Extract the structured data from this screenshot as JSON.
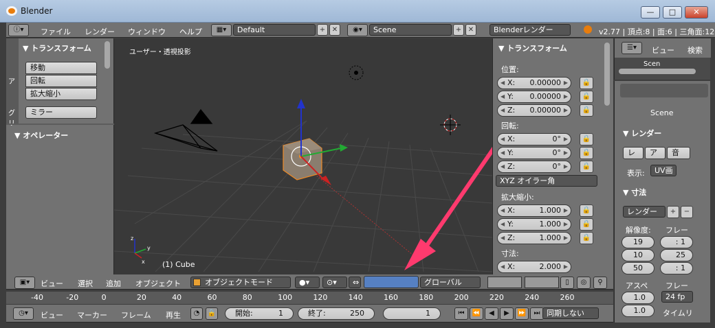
{
  "window": {
    "title": "Blender",
    "min": "—",
    "max": "□",
    "close": "✕"
  },
  "info_header": {
    "menus": [
      "ファイル",
      "レンダー",
      "ウィンドウ",
      "ヘルプ"
    ],
    "layout": "Default",
    "scene": "Scene",
    "engine": "Blenderレンダー",
    "stats": "v2.77 | 頂点:8 | 面:6 | 三角面:12"
  },
  "toolshelf": {
    "tabs": [
      "ア",
      "グリ"
    ],
    "transform_title": "▼ トランスフォーム",
    "buttons": [
      "移動",
      "回転",
      "拡大縮小"
    ],
    "mirror": "ミラー",
    "operator_title": "▼ オペレーター"
  },
  "viewport": {
    "label": "ユーザー・透視投影",
    "object_label": "(1) Cube",
    "axis_x": "x",
    "axis_y": "y",
    "axis_z": "z"
  },
  "properties_panel": {
    "title": "▼ トランスフォーム",
    "location_label": "位置:",
    "location": [
      {
        "axis": "X:",
        "value": "0.00000"
      },
      {
        "axis": "Y:",
        "value": "0.00000"
      },
      {
        "axis": "Z:",
        "value": "0.00000"
      }
    ],
    "rotation_label": "回転:",
    "rotation": [
      {
        "axis": "X:",
        "value": "0°"
      },
      {
        "axis": "Y:",
        "value": "0°"
      },
      {
        "axis": "Z:",
        "value": "0°"
      }
    ],
    "rotation_mode": "XYZ オイラー角",
    "scale_label": "拡大縮小:",
    "scale": [
      {
        "axis": "X:",
        "value": "1.000"
      },
      {
        "axis": "Y:",
        "value": "1.000"
      },
      {
        "axis": "Z:",
        "value": "1.000"
      }
    ],
    "dimensions_label": "寸法:",
    "dimensions": [
      {
        "axis": "X:",
        "value": "2.000"
      }
    ]
  },
  "view3d_header": {
    "menus": [
      "ビュー",
      "選択",
      "追加",
      "オブジェクト"
    ],
    "mode": "オブジェクトモード",
    "orientation": "グローバル"
  },
  "timeline": {
    "ticks": [
      "-40",
      "-20",
      "0",
      "20",
      "40",
      "60",
      "80",
      "100",
      "120",
      "140",
      "160",
      "180",
      "200",
      "220",
      "240",
      "260"
    ],
    "menus": [
      "ビュー",
      "マーカー",
      "フレーム",
      "再生"
    ],
    "start_label": "開始:",
    "start": "1",
    "end_label": "終了:",
    "end": "250",
    "current": "1",
    "sync": "同期しない"
  },
  "outliner": {
    "menus": [
      "ビュー",
      "検索"
    ],
    "scene": "Scen"
  },
  "properties_editor": {
    "scene": "Scene",
    "render_title": "▼ レンダー",
    "render_buttons": [
      "レ",
      "ア",
      "音"
    ],
    "display_label": "表示:",
    "display_value": "UV画",
    "dimensions_title": "▼ 寸法",
    "preset": "レンダー",
    "resolution_label": "解像度:",
    "frame_label": "フレー",
    "res_values": [
      "19",
      "10",
      "50"
    ],
    "frame_values": [
      ": 1",
      "25",
      ": 1"
    ],
    "aspect_label": "アスペ",
    "aspect_values": [
      "1.0",
      "1.0"
    ],
    "frame_rate_label": "フレー",
    "fps": "24 fp",
    "time_label": "タイムリ"
  },
  "colors": {
    "accent": "#ff3a6e",
    "viewport_bg": "#393939",
    "panel": "#727272"
  }
}
